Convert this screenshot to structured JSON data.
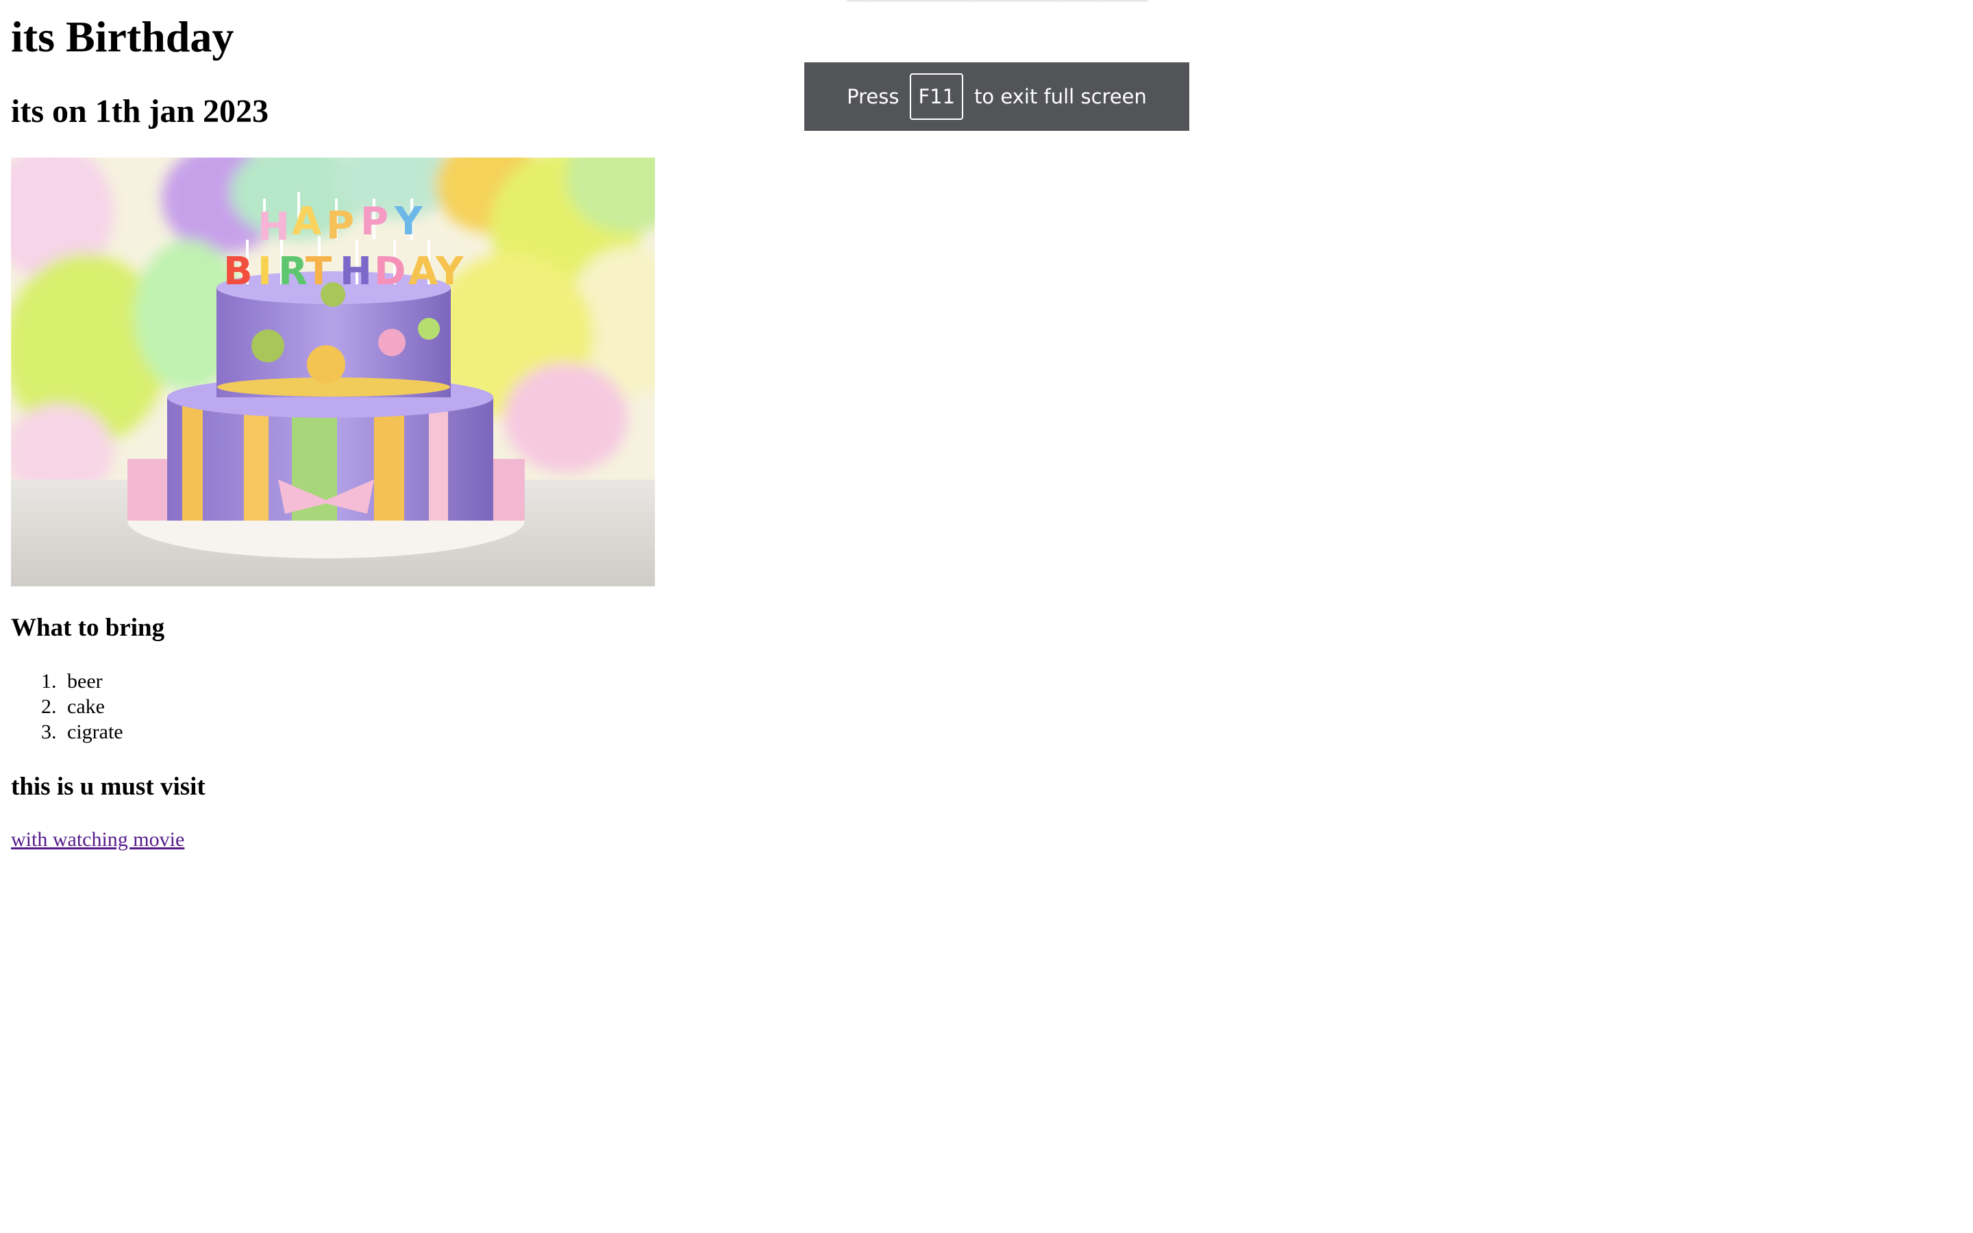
{
  "page": {
    "title": "its Birthday",
    "date_heading": "its on 1th jan 2023",
    "cake_image": {
      "description_name": "birthday-cake",
      "cake_topper": "HAPPY BIRTHDAY"
    },
    "bring_heading": "What to bring",
    "bring_items": [
      {
        "num": "1.",
        "label": "beer"
      },
      {
        "num": "2.",
        "label": "cake"
      },
      {
        "num": "3.",
        "label": "cigrate"
      }
    ],
    "visit_heading": "this is u must visit",
    "link_text": "with watching movie"
  },
  "fullscreen_toast": {
    "press": "Press",
    "key": "F11",
    "rest": "to exit full screen"
  },
  "colors": {
    "link_visited": "#551a8b",
    "toast_bg": "#535458"
  }
}
